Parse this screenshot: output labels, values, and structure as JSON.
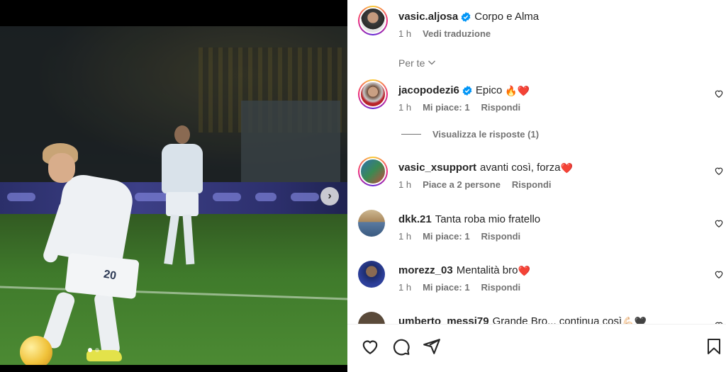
{
  "caption": {
    "username": "vasic.aljosa",
    "text": "Corpo e Alma",
    "time": "1 h",
    "translate": "Vedi traduzione"
  },
  "sort": {
    "label": "Per te"
  },
  "comments": [
    {
      "username": "jacopodezi6",
      "verified": true,
      "text": "Epico",
      "emoji": "🔥❤️",
      "time": "1 h",
      "likes": "Mi piace: 1",
      "reply": "Rispondi"
    },
    {
      "username": "vasic_xsupport",
      "verified": false,
      "text": "avanti così, forza",
      "emoji": "❤️",
      "time": "1 h",
      "likes": "Piace a 2 persone",
      "reply": "Rispondi"
    },
    {
      "username": "dkk.21",
      "verified": false,
      "text": "Tanta roba mio fratello",
      "emoji": "",
      "time": "1 h",
      "likes": "Mi piace: 1",
      "reply": "Rispondi"
    },
    {
      "username": "morezz_03",
      "verified": false,
      "text": "Mentalità bro",
      "emoji": "❤️",
      "time": "1 h",
      "likes": "Mi piace: 1",
      "reply": "Rispondi"
    },
    {
      "username": "umberto_messi79",
      "verified": false,
      "text": "Grande Bro... continua così",
      "emoji": "💪🏻🖤",
      "time": "",
      "likes": "",
      "reply": ""
    }
  ],
  "replies": {
    "label": "Visualizza le risposte (1)"
  },
  "media": {
    "jersey_number": "20"
  },
  "colors": {
    "verified": "#0095f6",
    "heart_red": "#e0242b",
    "text": "#262626",
    "meta": "#737373"
  },
  "icons": [
    "heart-icon",
    "comment-icon",
    "share-icon",
    "bookmark-icon",
    "chevron-down-icon",
    "chevron-right-icon",
    "verified-icon"
  ]
}
